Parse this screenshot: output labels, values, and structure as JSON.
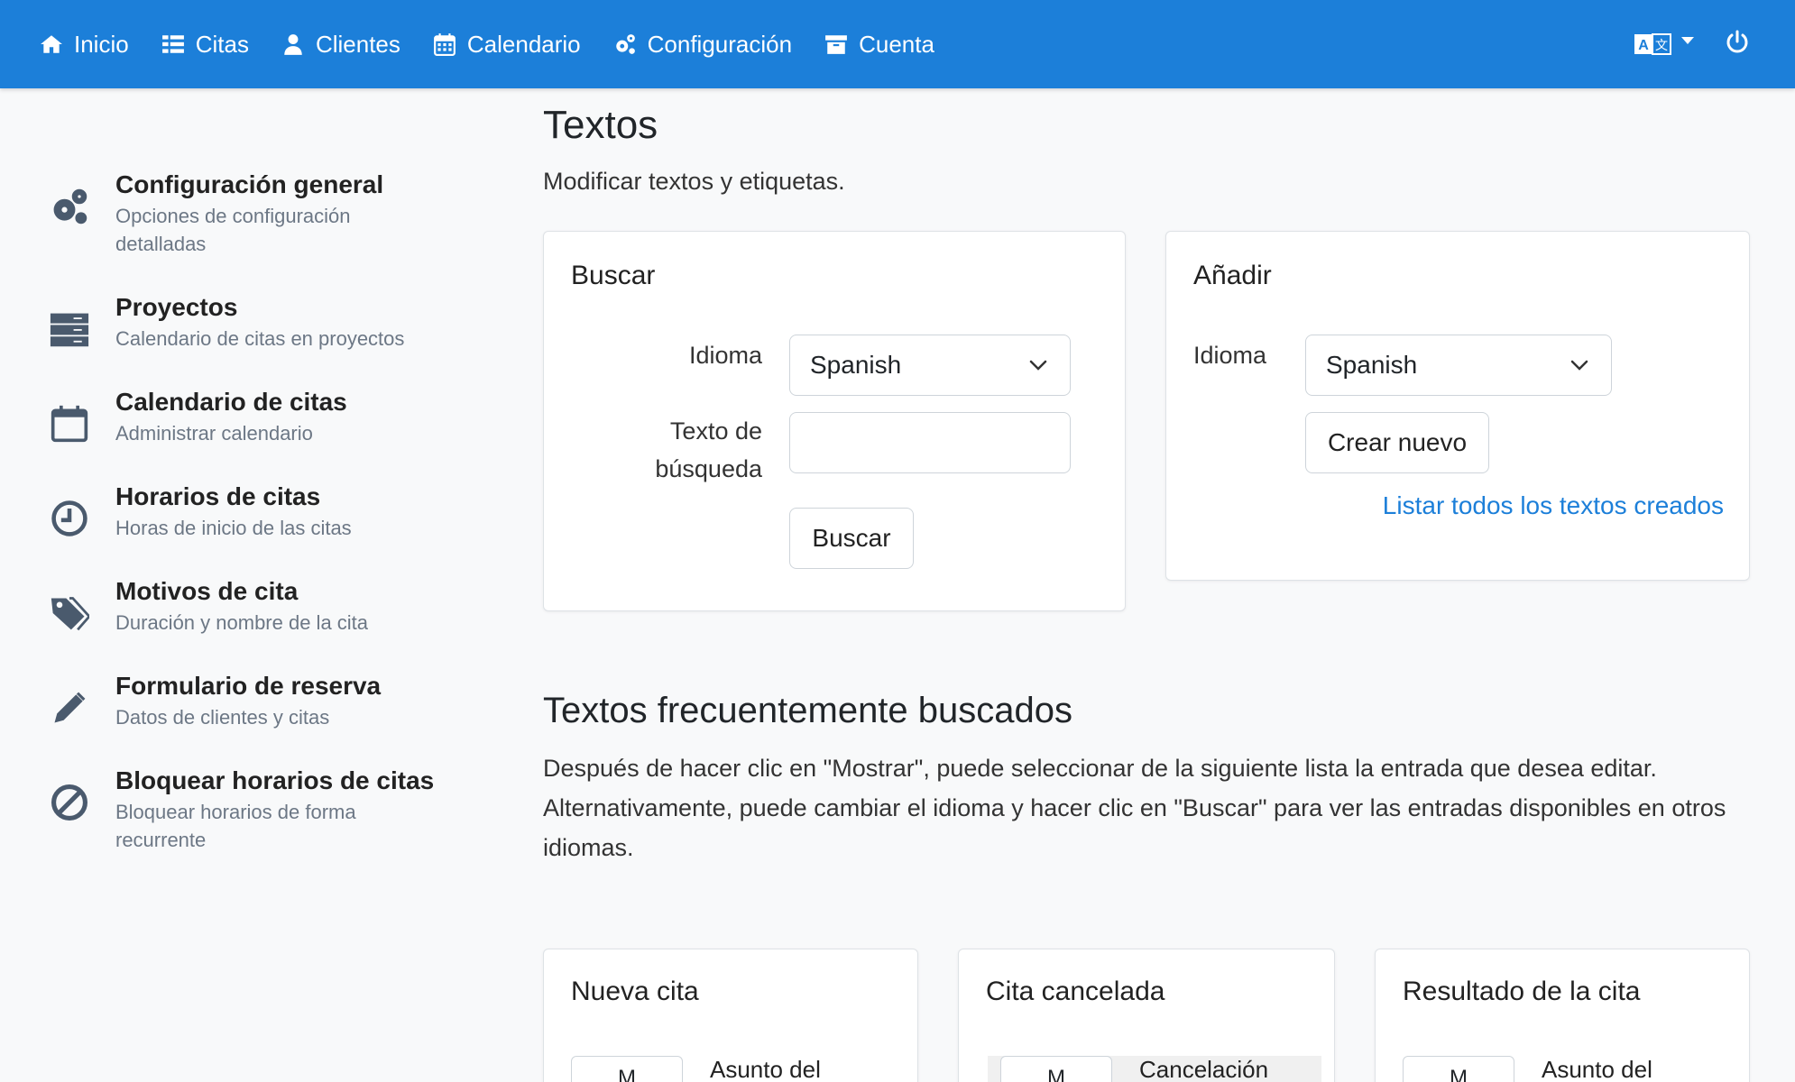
{
  "nav": {
    "items": [
      {
        "label": "Inicio",
        "icon": "home-icon"
      },
      {
        "label": "Citas",
        "icon": "list-icon"
      },
      {
        "label": "Clientes",
        "icon": "user-icon"
      },
      {
        "label": "Calendario",
        "icon": "calendar-icon"
      },
      {
        "label": "Configuración",
        "icon": "gears-icon"
      },
      {
        "label": "Cuenta",
        "icon": "archive-icon"
      }
    ],
    "accent": "#1c7fd9"
  },
  "sidebar": {
    "items": [
      {
        "title": "Configuración general",
        "desc": "Opciones de configuración detalladas",
        "icon": "gears-icon"
      },
      {
        "title": "Proyectos",
        "desc": "Calendario de citas en proyectos",
        "icon": "server-icon"
      },
      {
        "title": "Calendario de citas",
        "desc": "Administrar calendario",
        "icon": "calendar-icon"
      },
      {
        "title": "Horarios de citas",
        "desc": "Horas de inicio de las citas",
        "icon": "clock-icon"
      },
      {
        "title": "Motivos de cita",
        "desc": "Duración y nombre de la cita",
        "icon": "tags-icon"
      },
      {
        "title": "Formulario de reserva",
        "desc": "Datos de clientes y citas",
        "icon": "pencil-icon"
      },
      {
        "title": "Bloquear horarios de citas",
        "desc": "Bloquear horarios de forma recurrente",
        "icon": "ban-icon"
      }
    ]
  },
  "main": {
    "title": "Textos",
    "subtitle": "Modificar textos y etiquetas.",
    "search_card": {
      "title": "Buscar",
      "language_label": "Idioma",
      "language_value": "Spanish",
      "search_label": "Texto de búsqueda",
      "search_value": "",
      "button": "Buscar"
    },
    "add_card": {
      "title": "Añadir",
      "language_label": "Idioma",
      "language_value": "Spanish",
      "button": "Crear nuevo",
      "link": "Listar todos los textos creados"
    },
    "frequent": {
      "title": "Textos frecuentemente buscados",
      "desc": "Después de hacer clic en \"Mostrar\", puede seleccionar de la siguiente lista la entrada que desea editar. Alternativamente, puede cambiar el idioma y hacer clic en \"Buscar\" para ver las entradas disponibles en otros idiomas.",
      "cards": [
        {
          "title": "Nueva cita",
          "row_button": "M",
          "row_text": "Asunto del"
        },
        {
          "title": "Cita cancelada",
          "row_button": "M",
          "row_text": "Cancelación"
        },
        {
          "title": "Resultado de la cita",
          "row_button": "M",
          "row_text": "Asunto del"
        }
      ]
    }
  }
}
